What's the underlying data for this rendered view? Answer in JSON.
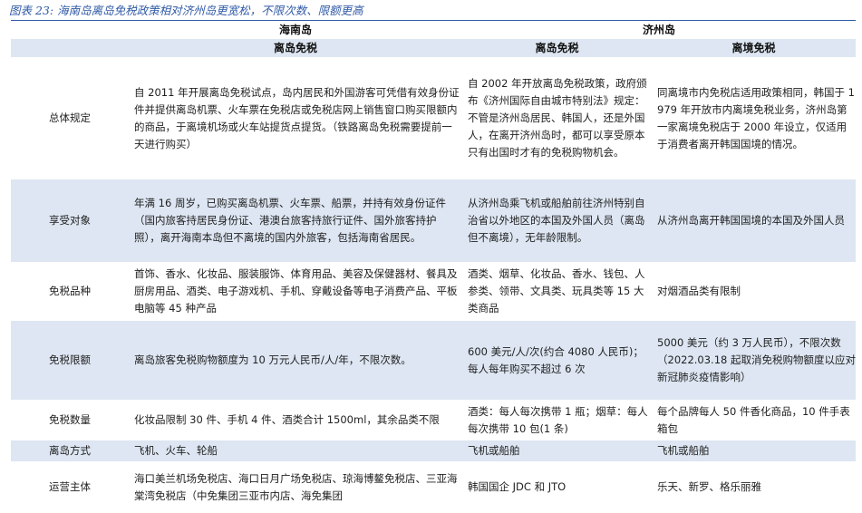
{
  "figure_title": "图表 23:  海南岛离岛免税政策相对济州岛更宽松，不限次数、限额更高",
  "headers": {
    "hainan": "海南岛",
    "jeju": "济州岛",
    "hainan_sub": "离岛免税",
    "jeju_sub1": "离岛免税",
    "jeju_sub2": "离境免税"
  },
  "rows": [
    {
      "label": "总体规定",
      "hainan": "自 2011 年开展离岛免税试点，岛内居民和外国游客可凭借有效身份证件并提供离岛机票、火车票在免税店或免税店网上销售窗口购买限额内的商品，于离境机场或火车站提货点提货。（铁路离岛免税需要提前一天进行购买）",
      "jeju_offisland": "自 2002 年开放离岛免税政策，政府颁布《济州国际自由城市特别法》规定：不管是济州岛居民、韩国人，还是外国人，在离开济州岛时，都可以享受原本只有出国时才有的免税购物机会。",
      "jeju_departure": "同离境市内免税店适用政策相同，韩国于 1979 年开放市内离境免税业务，济州岛第一家离境免税店于 2000 年设立，仅适用于消费者离开韩国国境的情况。"
    },
    {
      "label": "享受对象",
      "hainan": "年满 16 周岁，已购买离岛机票、火车票、船票，并持有效身份证件（国内旅客持居民身份证、港澳台旅客持旅行证件、国外旅客持护照），离开海南本岛但不离境的国内外旅客，包括海南省居民。",
      "jeju_offisland": "从济州岛乘飞机或船舶前往济州特别自治省以外地区的本国及外国人员（离岛但不离境），无年龄限制。",
      "jeju_departure": "从济州岛离开韩国国境的本国及外国人员"
    },
    {
      "label": "免税品种",
      "hainan": "首饰、香水、化妆品、服装服饰、体育用品、美容及保健器材、餐具及厨房用品、酒类、电子游戏机、手机、穿戴设备等电子消费产品、平板电脑等 45 种产品",
      "jeju_offisland": "酒类、烟草、化妆品、香水、钱包、人参类、领带、文具类、玩具类等 15 大类商品",
      "jeju_departure": "对烟酒品类有限制"
    },
    {
      "label": "免税限额",
      "hainan": "离岛旅客免税购物额度为 10 万元人民币/人/年，不限次数。",
      "jeju_offisland": "600 美元/人/次(约合 4080 人民币)；每人每年购买不超过 6 次",
      "jeju_departure": "5000 美元（约 3 万人民币），不限次数（2022.03.18 起取消免税购物额度以应对新冠肺炎疫情影响）"
    },
    {
      "label": "免税数量",
      "hainan": "化妆品限制 30 件、手机 4 件、酒类合计 1500ml，其余品类不限",
      "jeju_offisland": "酒类：每人每次携带 1 瓶；烟草：每人每次携带 10 包(1 条)",
      "jeju_departure": "每个品牌每人 50 件香化商品，10 件手表箱包"
    },
    {
      "label": "离岛方式",
      "hainan": "飞机、火车、轮船",
      "jeju_offisland": "飞机或船舶",
      "jeju_departure": "飞机或船舶"
    },
    {
      "label": "运营主体",
      "hainan": "海口美兰机场免税店、海口日月广场免税店、琼海博鳌免税店、三亚海棠湾免税店（中免集团三亚市内店、海免集团",
      "jeju_offisland": "韩国国企 JDC 和 JTO",
      "jeju_departure": "乐天、新罗、格乐丽雅"
    }
  ]
}
